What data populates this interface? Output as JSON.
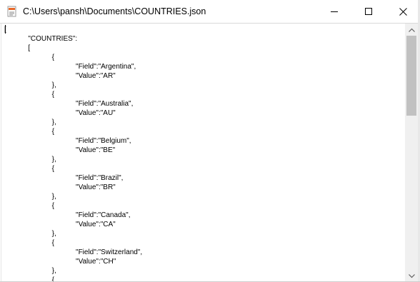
{
  "window": {
    "title": "C:\\Users\\pansh\\Documents\\COUNTRIES.json",
    "controls": {
      "minimize": "minimize",
      "maximize": "maximize",
      "close": "close"
    },
    "icon": "notepad-document-icon"
  },
  "document": {
    "lines": [
      "[",
      "\t\"COUNTRIES\":",
      "\t[",
      "\t\t{",
      "\t\t\t\"Field\":\"Argentina\",",
      "\t\t\t\"Value\":\"AR\"",
      "\t\t},",
      "\t\t{",
      "\t\t\t\"Field\":\"Australia\",",
      "\t\t\t\"Value\":\"AU\"",
      "\t\t},",
      "\t\t{",
      "\t\t\t\"Field\":\"Belgium\",",
      "\t\t\t\"Value\":\"BE\"",
      "\t\t},",
      "\t\t{",
      "\t\t\t\"Field\":\"Brazil\",",
      "\t\t\t\"Value\":\"BR\"",
      "\t\t},",
      "\t\t{",
      "\t\t\t\"Field\":\"Canada\",",
      "\t\t\t\"Value\":\"CA\"",
      "\t\t},",
      "\t\t{",
      "\t\t\t\"Field\":\"Switzerland\",",
      "\t\t\t\"Value\":\"CH\"",
      "\t\t},",
      "\t\t{"
    ]
  },
  "scrollbar": {
    "up_icon": "scroll-up-icon",
    "down_icon": "scroll-down-icon"
  },
  "colors": {
    "titlebar": "#ffffff",
    "icon_accent": "#e8692a",
    "scrollbar_track": "#f0f0f0",
    "scrollbar_thumb": "#c1c1c1"
  }
}
